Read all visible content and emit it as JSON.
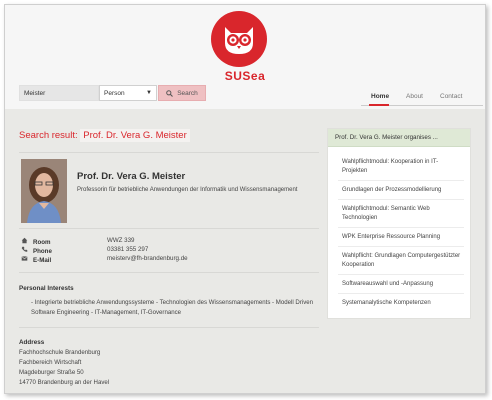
{
  "brand": {
    "name": "SUSea",
    "logo_color": "#d9262c"
  },
  "search": {
    "value": "Meister",
    "type_selected": "Person",
    "button_label": "Search"
  },
  "nav": {
    "items": [
      "Home",
      "About",
      "Contact"
    ],
    "active": "Home"
  },
  "result": {
    "prefix": "Search result:",
    "name": "Prof. Dr. Vera G. Meister"
  },
  "person": {
    "name": "Prof. Dr. Vera G. Meister",
    "title": "Professorin für betriebliche Anwendungen der Informatik und Wissensmanagement",
    "room_label": "Room",
    "room": "WWZ 339",
    "phone_label": "Phone",
    "phone": "03381 355 297",
    "email_label": "E-Mail",
    "email": "meisterv@fh-brandenburg.de"
  },
  "interests": {
    "heading": "Personal Interests",
    "text": "- Integrierte betriebliche Anwendungssysteme - Technologien des Wissensmanagements - Modell Driven Software Engineering - IT-Management, IT-Governance"
  },
  "address": {
    "heading": "Address",
    "lines": [
      "Fachhochschule Brandenburg",
      "Fachbereich Wirtschaft",
      "Magdeburger Straße 50",
      "14770 Brandenburg an der Havel"
    ]
  },
  "sidebar": {
    "heading": "Prof. Dr. Vera G. Meister organises ...",
    "items": [
      "Wahlpflichtmodul: Kooperation in IT-Projekten",
      "Grundlagen der Prozessmodellierung",
      "Wahlpflichtmodul: Semantic Web Technologien",
      "WPK Enterprise Ressource Planning",
      "Wahlpflicht: Grundlagen Computergestützter Kooperation",
      "Softwareauswahl und -Anpassung",
      "Systemanalytische Kompetenzen"
    ]
  }
}
